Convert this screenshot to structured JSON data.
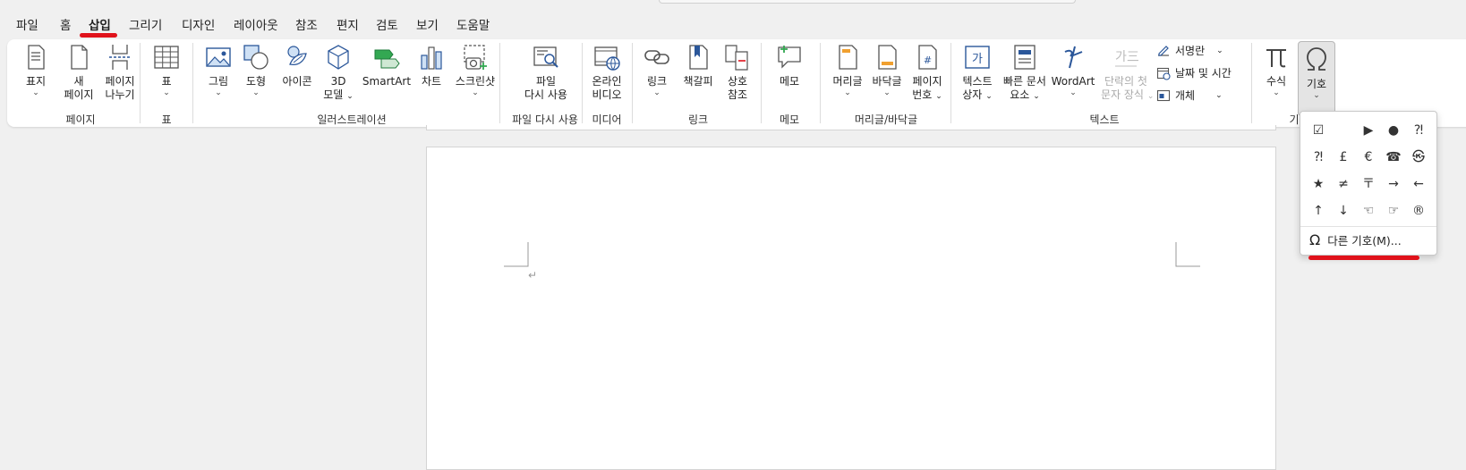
{
  "menu_tabs": [
    "파일",
    "홈",
    "삽입",
    "그리기",
    "디자인",
    "레이아웃",
    "참조",
    "편지",
    "검토",
    "보기",
    "도움말"
  ],
  "groups": {
    "pages": {
      "label": "페이지",
      "cover": "표지",
      "new_page_1": "새",
      "new_page_2": "페이지",
      "break_1": "페이지",
      "break_2": "나누기"
    },
    "table": {
      "label": "표",
      "table": "표"
    },
    "illustrations": {
      "label": "일러스트레이션",
      "picture": "그림",
      "shapes": "도형",
      "icons": "아이콘",
      "model_1": "3D",
      "model_2": "모델",
      "smartart": "SmartArt",
      "chart": "차트",
      "screenshot": "스크린샷"
    },
    "reuse": {
      "label": "파일 다시 사용",
      "reuse_1": "파일",
      "reuse_2": "다시 사용"
    },
    "media": {
      "label": "미디어",
      "video_1": "온라인",
      "video_2": "비디오"
    },
    "links": {
      "label": "링크",
      "link": "링크",
      "bookmark": "책갈피",
      "xref_1": "상호",
      "xref_2": "참조"
    },
    "comments": {
      "label": "메모",
      "comment": "메모"
    },
    "header_footer": {
      "label": "머리글/바닥글",
      "header": "머리글",
      "footer": "바닥글",
      "pagenum_1": "페이지",
      "pagenum_2": "번호"
    },
    "text": {
      "label": "텍스트",
      "textbox_1": "텍스트",
      "textbox_2": "상자",
      "quickparts_1": "빠른 문서",
      "quickparts_2": "요소",
      "wordart": "WordArt",
      "dropcap_1": "단락의 첫",
      "dropcap_2": "문자 장식",
      "signature": "서명란",
      "datetime": "날짜 및 시간",
      "object": "개체",
      "textbox_icon_text": "가",
      "dropcap_icon_text": "가三"
    },
    "symbols": {
      "label": "기",
      "equation": "수식",
      "symbol": "기호"
    }
  },
  "symbol_dropdown": {
    "symbols": [
      "☑",
      "",
      "▶",
      "●",
      "⁈",
      "⁈",
      "£",
      "€",
      "☎",
      "㉿",
      "★",
      "≠",
      "〒",
      "→",
      "←",
      "↑",
      "↓",
      "☜",
      "☞",
      "®"
    ],
    "more_label": "다른 기호(M)..."
  },
  "colors": {
    "accent": "#2b579a",
    "red_mark": "#e0121b",
    "ribbon_bg": "#ffffff",
    "app_bg": "#f0f0f0"
  }
}
